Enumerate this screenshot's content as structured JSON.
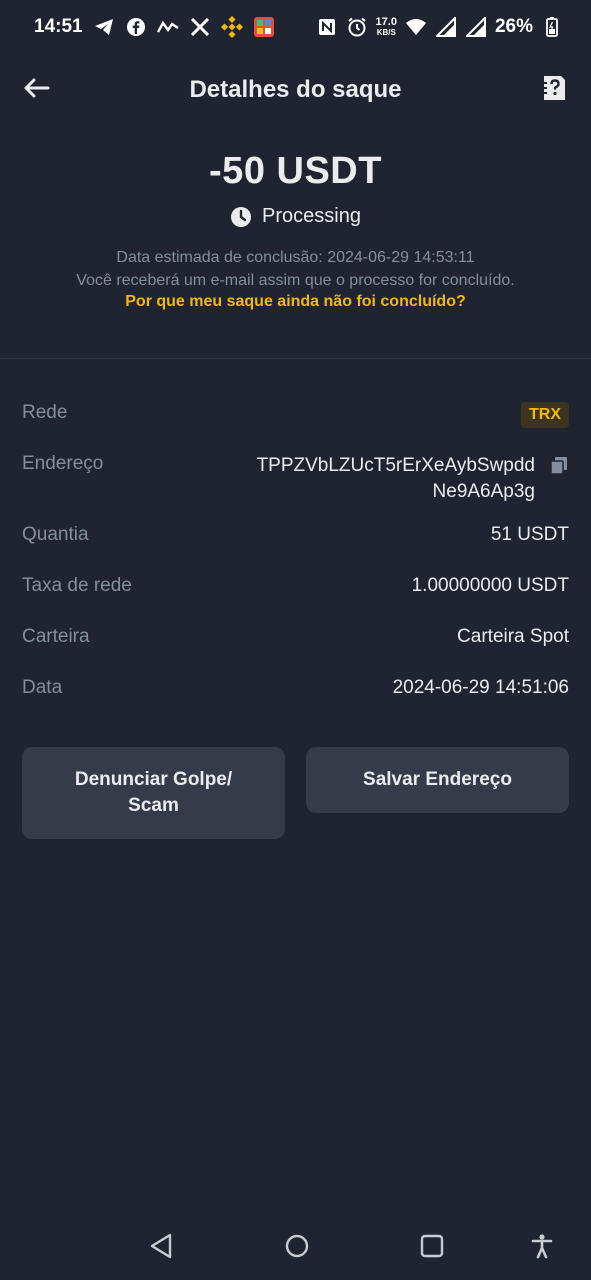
{
  "status_bar": {
    "time": "14:51",
    "net_speed_value": "17.0",
    "net_speed_unit": "KB/S",
    "battery": "26%",
    "left_icons": [
      "telegram-icon",
      "facebook-icon",
      "trend-icon",
      "x-icon",
      "binance-icon",
      "game-icon"
    ],
    "right_icons": [
      "nfc-icon",
      "alarm-icon",
      "wifi-icon",
      "signal-icon",
      "signal-icon",
      "battery-icon"
    ]
  },
  "header": {
    "title": "Detalhes do saque",
    "back_icon": "arrow-left-icon",
    "help_icon": "help-document-icon"
  },
  "summary": {
    "amount": "-50 USDT",
    "status": "Processing",
    "estimate": "Data estimada de conclusão: 2024-06-29 14:53:11",
    "email_notice": "Você receberá um e-mail assim que o processo for concluído.",
    "why_link": "Por que meu saque ainda não foi concluído?"
  },
  "details": {
    "network_label": "Rede",
    "network_value": "TRX",
    "address_label": "Endereço",
    "address_value": "TPPZVbLZUcT5rErXeAybSwpddNe9A6Ap3g",
    "amount_label": "Quantia",
    "amount_value": "51 USDT",
    "fee_label": "Taxa de rede",
    "fee_value": "1.00000000 USDT",
    "wallet_label": "Carteira",
    "wallet_value": "Carteira Spot",
    "date_label": "Data",
    "date_value": "2024-06-29 14:51:06"
  },
  "actions": {
    "report_label": "Denunciar Golpe/ Scam",
    "save_label": "Salvar Endereço"
  },
  "colors": {
    "background": "#1f2430",
    "accent": "#f0b90b",
    "muted_text": "#848e9c",
    "button": "#353b48"
  }
}
